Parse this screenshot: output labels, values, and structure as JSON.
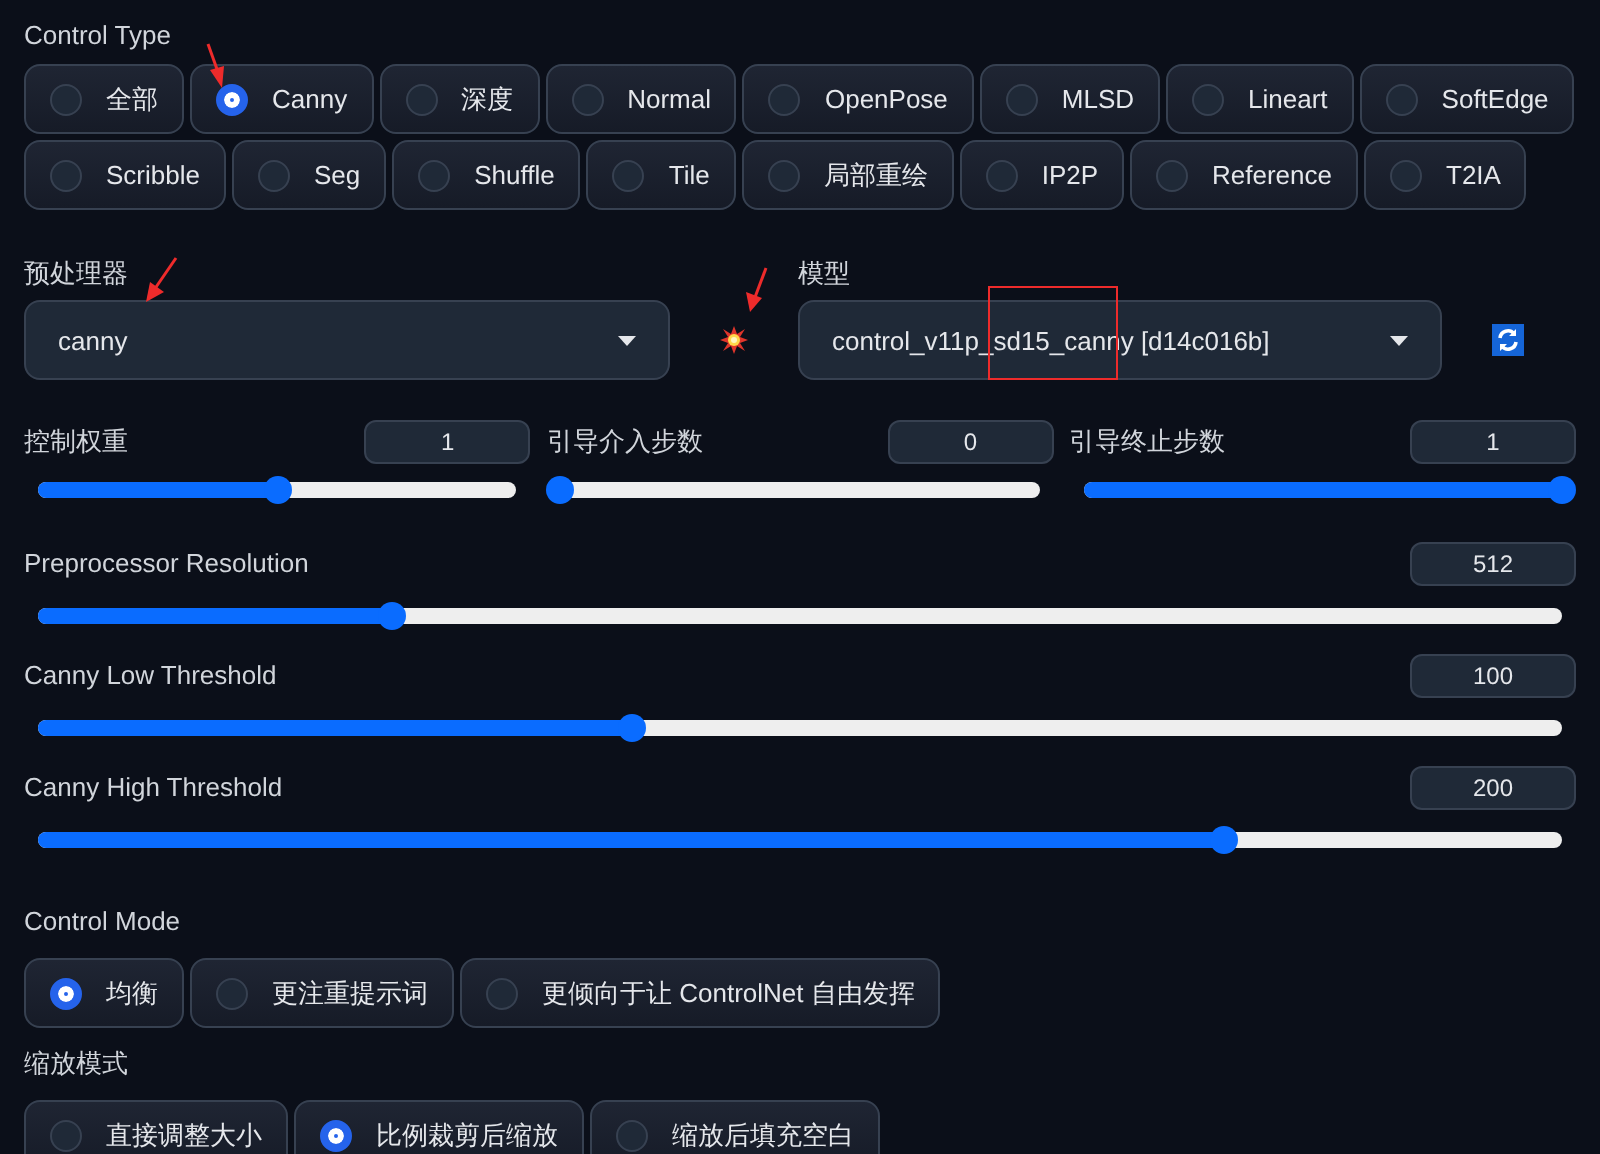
{
  "control_type": {
    "label": "Control Type",
    "options": [
      {
        "label": "全部",
        "selected": false
      },
      {
        "label": "Canny",
        "selected": true
      },
      {
        "label": "深度",
        "selected": false
      },
      {
        "label": "Normal",
        "selected": false
      },
      {
        "label": "OpenPose",
        "selected": false
      },
      {
        "label": "MLSD",
        "selected": false
      },
      {
        "label": "Lineart",
        "selected": false
      },
      {
        "label": "SoftEdge",
        "selected": false
      },
      {
        "label": "Scribble",
        "selected": false
      },
      {
        "label": "Seg",
        "selected": false
      },
      {
        "label": "Shuffle",
        "selected": false
      },
      {
        "label": "Tile",
        "selected": false
      },
      {
        "label": "局部重绘",
        "selected": false
      },
      {
        "label": "IP2P",
        "selected": false
      },
      {
        "label": "Reference",
        "selected": false
      },
      {
        "label": "T2IA",
        "selected": false
      }
    ]
  },
  "preprocessor": {
    "label": "预处理器",
    "value": "canny"
  },
  "model": {
    "label": "模型",
    "value": "control_v11p_sd15_canny [d14c016b]"
  },
  "step_sliders": [
    {
      "label": "控制权重",
      "value": "1",
      "level": 0.5
    },
    {
      "label": "引导介入步数",
      "value": "0",
      "level": 0
    },
    {
      "label": "引导终止步数",
      "value": "1",
      "level": 1
    }
  ],
  "sliders": [
    {
      "label": "Preprocessor Resolution",
      "value": "512",
      "level": 0.232
    },
    {
      "label": "Canny Low Threshold",
      "value": "100",
      "level": 0.39
    },
    {
      "label": "Canny High Threshold",
      "value": "200",
      "level": 0.778
    }
  ],
  "control_mode": {
    "label": "Control Mode",
    "options": [
      {
        "label": "均衡",
        "selected": true
      },
      {
        "label": "更注重提示词",
        "selected": false
      },
      {
        "label": "更倾向于让 ControlNet 自由发挥",
        "selected": false
      }
    ]
  },
  "resize_mode": {
    "label": "缩放模式",
    "options": [
      {
        "label": "直接调整大小",
        "selected": false
      },
      {
        "label": "比例裁剪后缩放",
        "selected": true
      },
      {
        "label": "缩放后填充空白",
        "selected": false
      }
    ]
  }
}
